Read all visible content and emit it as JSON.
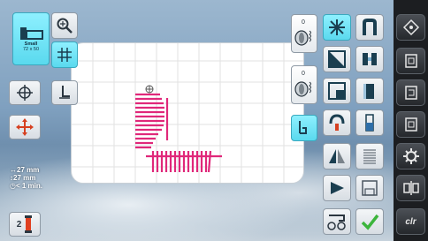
{
  "hoop_button": {
    "size_label": "Small",
    "dims_label": "72 x 50"
  },
  "status": {
    "width": "27 mm",
    "height": "27 mm",
    "time": "< 1 min."
  },
  "color_indicator": {
    "number": "2"
  },
  "sidebar": {
    "clr_label": "clr"
  },
  "colors": {
    "active": "#5ad9ee",
    "stitch": "#e0287a",
    "ok_check": "#3cb53c",
    "cursor_icon": "#d64020"
  }
}
